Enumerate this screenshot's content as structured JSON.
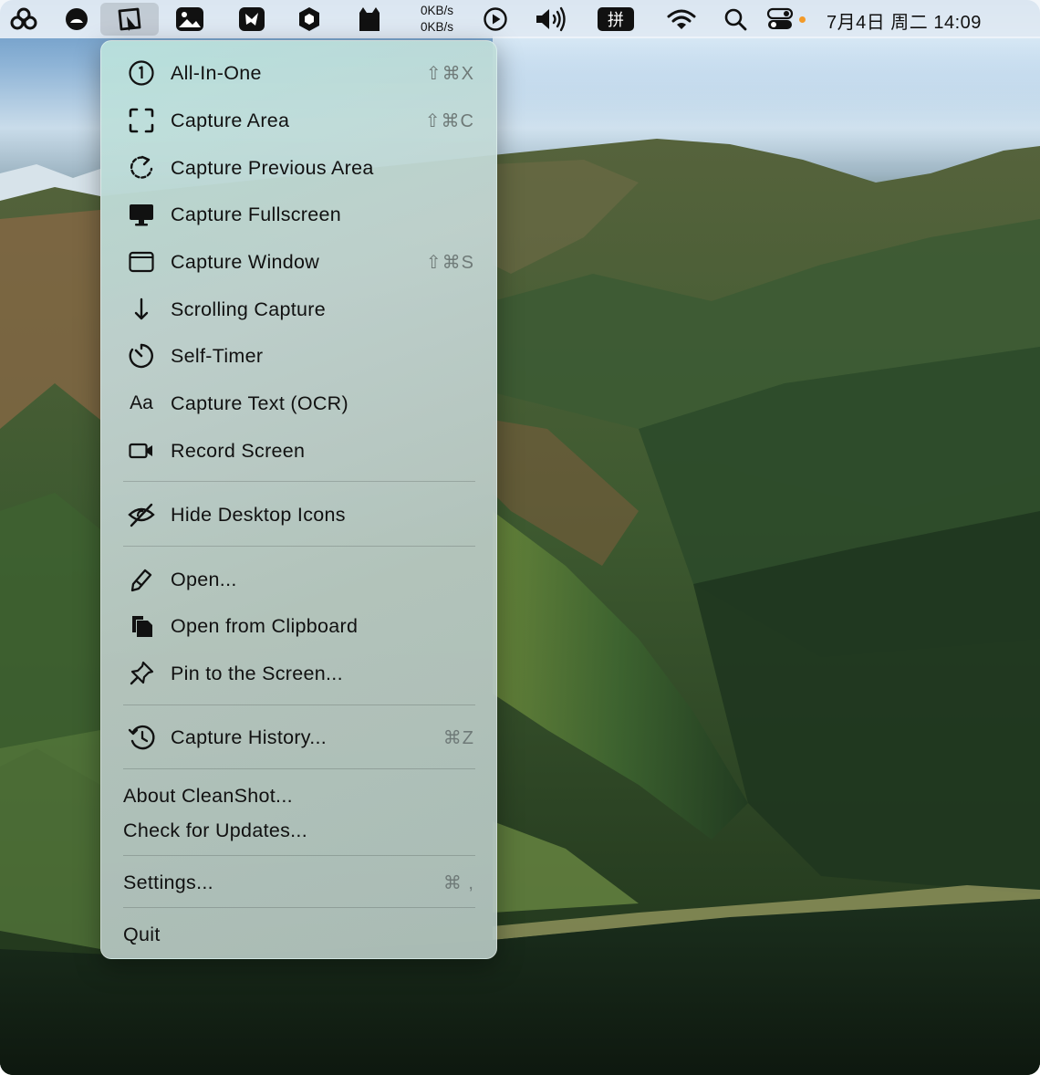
{
  "menubar": {
    "network_up": "0KB/s",
    "network_down": "0KB/s",
    "clock": "7月4日 周二  14:09",
    "input_method_label": "拼",
    "status_dot_color": "#f39a28",
    "icons": [
      "three-circles-icon",
      "dark-circle-icon",
      "cleanshot-icon",
      "image-icon",
      "bird-app-icon",
      "hexagon-icon",
      "cat-icon",
      "play-circle-icon",
      "speaker-icon",
      "input-method-icon",
      "wifi-icon",
      "search-icon",
      "control-center-icon"
    ]
  },
  "menu": {
    "capture_items": [
      {
        "label": "All-In-One",
        "shortcut": "⇧⌘X",
        "icon": "number-one-circle-icon"
      },
      {
        "label": "Capture Area",
        "shortcut": "⇧⌘C",
        "icon": "capture-area-icon"
      },
      {
        "label": "Capture Previous Area",
        "shortcut": "",
        "icon": "dashed-refresh-icon"
      },
      {
        "label": "Capture Fullscreen",
        "shortcut": "",
        "icon": "display-icon"
      },
      {
        "label": "Capture Window",
        "shortcut": "⇧⌘S",
        "icon": "window-icon"
      },
      {
        "label": "Scrolling Capture",
        "shortcut": "",
        "icon": "arrow-down-icon"
      },
      {
        "label": "Self-Timer",
        "shortcut": "",
        "icon": "timer-icon"
      },
      {
        "label": "Capture Text (OCR)",
        "shortcut": "",
        "icon": "text-aa-icon",
        "icon_text": "Aa"
      },
      {
        "label": "Record Screen",
        "shortcut": "",
        "icon": "video-camera-icon"
      }
    ],
    "hide_desktop_icons": {
      "label": "Hide Desktop Icons",
      "icon": "eye-slash-icon"
    },
    "open_items": [
      {
        "label": "Open...",
        "icon": "pencil-icon"
      },
      {
        "label": "Open from Clipboard",
        "icon": "clipboard-doc-icon"
      },
      {
        "label": "Pin to the Screen...",
        "icon": "pin-icon"
      }
    ],
    "history": {
      "label": "Capture History...",
      "shortcut": "⌘Z",
      "icon": "history-clock-icon"
    },
    "about": "About CleanShot...",
    "check_updates": "Check for Updates...",
    "settings": {
      "label": "Settings...",
      "shortcut": "⌘ ,"
    },
    "quit": "Quit"
  }
}
